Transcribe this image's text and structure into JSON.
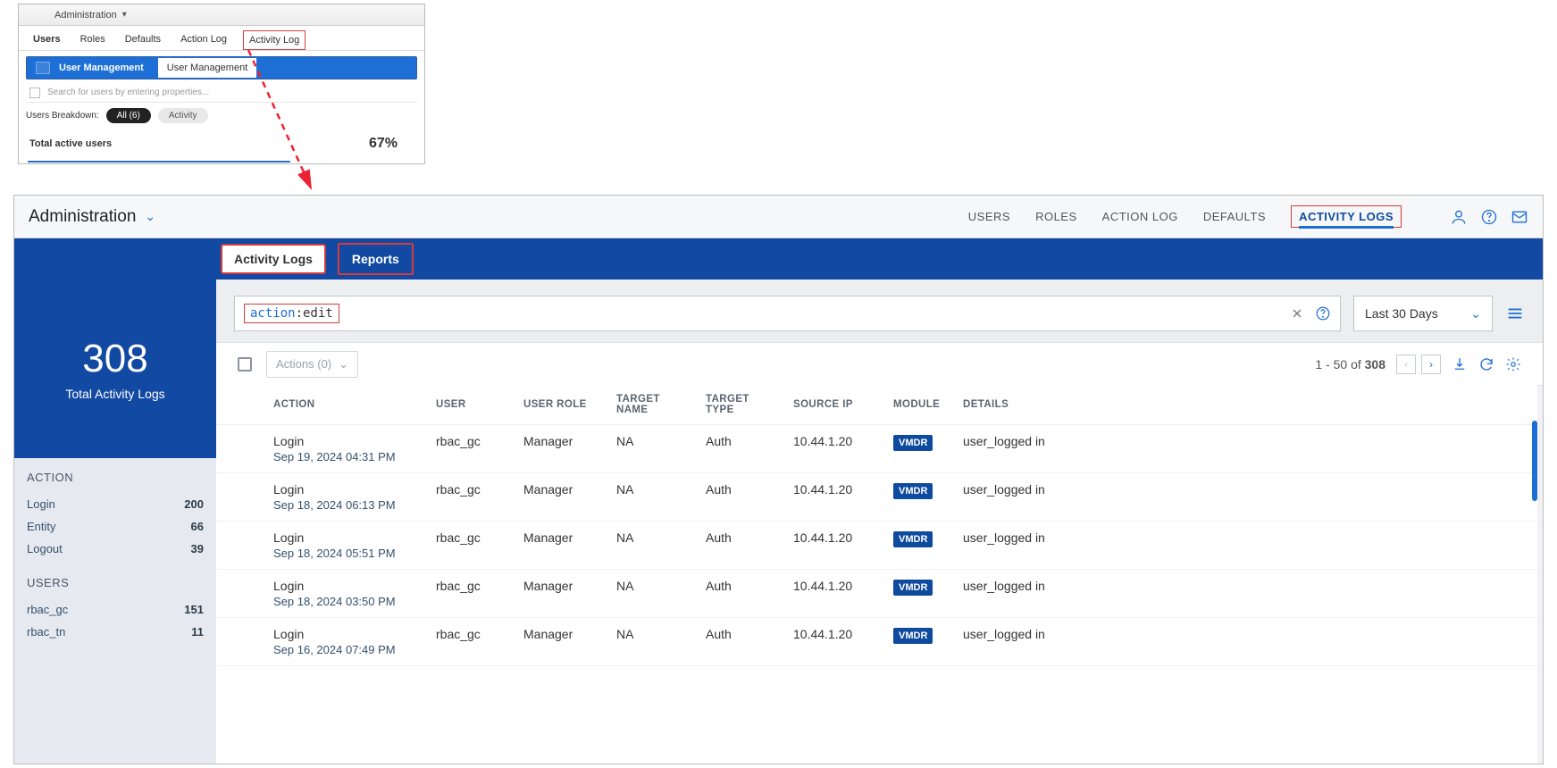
{
  "thumb": {
    "admin_label": "Administration",
    "tabs": [
      "Users",
      "Roles",
      "Defaults",
      "Action Log",
      "Activity Log"
    ],
    "um_label": "User Management",
    "um_tab": "User Management",
    "search_placeholder": "Search for users by entering properties...",
    "breakdown_label": "Users Breakdown:",
    "pill_all": "All  (6)",
    "pill_activity": "Activity",
    "active_label": "Total active users",
    "active_pct": "67%"
  },
  "top": {
    "title": "Administration",
    "nav": {
      "users": "USERS",
      "roles": "ROLES",
      "actionlog": "ACTION LOG",
      "defaults": "DEFAULTS",
      "activitylogs": "ACTIVITY LOGS"
    }
  },
  "subtabs": {
    "activity": "Activity Logs",
    "reports": "Reports"
  },
  "search": {
    "key": "action",
    "val": ":edit",
    "daterange": "Last 30 Days"
  },
  "sidebar": {
    "total_count": "308",
    "total_label": "Total Activity Logs",
    "action_header": "ACTION",
    "actions": [
      {
        "name": "Login",
        "count": "200"
      },
      {
        "name": "Entity",
        "count": "66"
      },
      {
        "name": "Logout",
        "count": "39"
      }
    ],
    "users_header": "USERS",
    "users": [
      {
        "name": "rbac_gc",
        "count": "151"
      },
      {
        "name": "rbac_tn",
        "count": "11"
      }
    ]
  },
  "toolbar": {
    "actions_btn": "Actions (0)",
    "range_prefix": "1 - 50 of ",
    "range_total": "308"
  },
  "columns": {
    "action": "ACTION",
    "user": "USER",
    "role": "USER ROLE",
    "target": "TARGET NAME",
    "ttype": "TARGET TYPE",
    "ip": "SOURCE IP",
    "module": "MODULE",
    "details": "DETAILS"
  },
  "rows": [
    {
      "action": "Login",
      "ts": "Sep 19, 2024 04:31 PM",
      "user": "rbac_gc",
      "role": "Manager",
      "target": "NA",
      "ttype": "Auth",
      "ip": "10.44.1.20",
      "module": "VMDR",
      "details": "user_logged in"
    },
    {
      "action": "Login",
      "ts": "Sep 18, 2024 06:13 PM",
      "user": "rbac_gc",
      "role": "Manager",
      "target": "NA",
      "ttype": "Auth",
      "ip": "10.44.1.20",
      "module": "VMDR",
      "details": "user_logged in"
    },
    {
      "action": "Login",
      "ts": "Sep 18, 2024 05:51 PM",
      "user": "rbac_gc",
      "role": "Manager",
      "target": "NA",
      "ttype": "Auth",
      "ip": "10.44.1.20",
      "module": "VMDR",
      "details": "user_logged in"
    },
    {
      "action": "Login",
      "ts": "Sep 18, 2024 03:50 PM",
      "user": "rbac_gc",
      "role": "Manager",
      "target": "NA",
      "ttype": "Auth",
      "ip": "10.44.1.20",
      "module": "VMDR",
      "details": "user_logged in"
    },
    {
      "action": "Login",
      "ts": "Sep 16, 2024 07:49 PM",
      "user": "rbac_gc",
      "role": "Manager",
      "target": "NA",
      "ttype": "Auth",
      "ip": "10.44.1.20",
      "module": "VMDR",
      "details": "user_logged in"
    }
  ]
}
